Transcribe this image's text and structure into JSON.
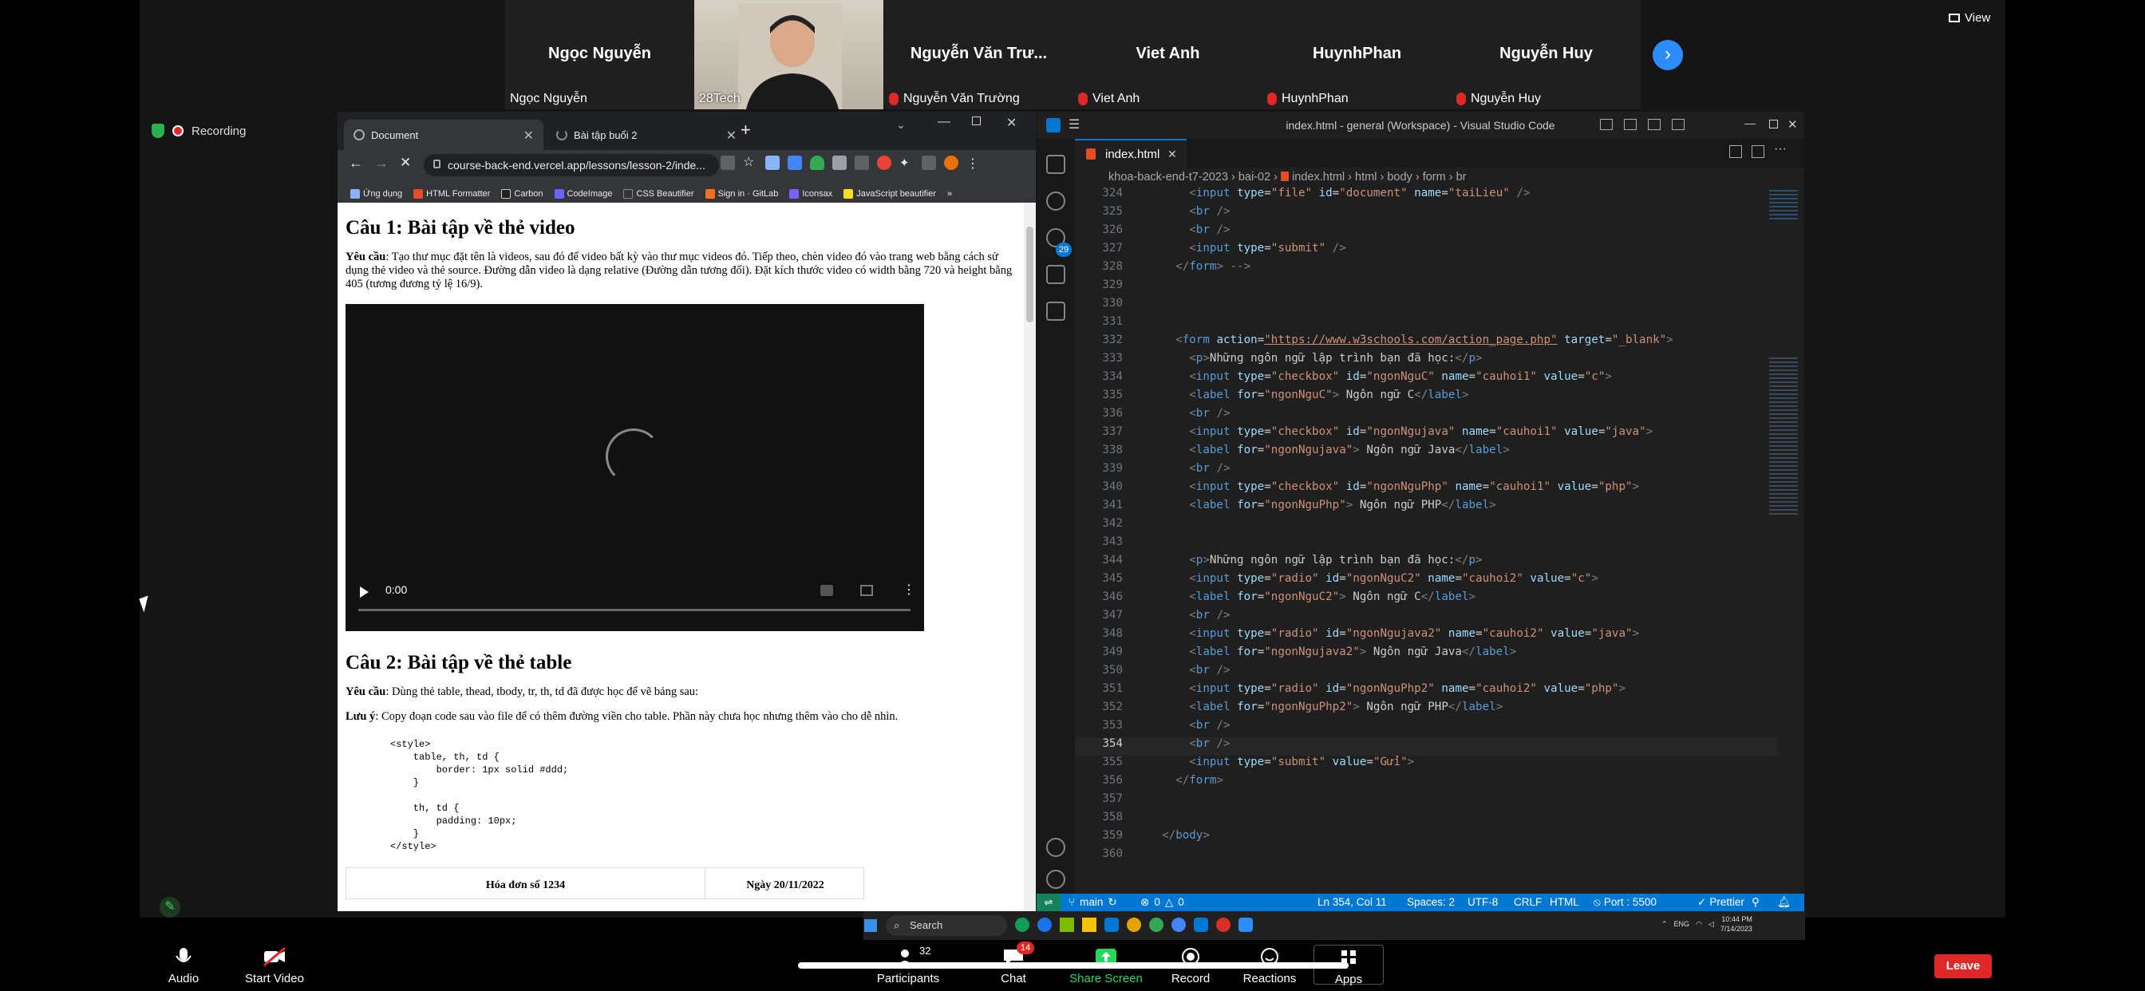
{
  "top_bar": {
    "view_label": "View"
  },
  "recording": {
    "label": "Recording"
  },
  "participants_tiles": [
    {
      "name": "Ngọc Nguyễn",
      "subname": "Ngọc Nguyễn"
    },
    {
      "name": "",
      "subname": "28Tech"
    },
    {
      "name": "Nguyễn Văn Trư...",
      "subname": "Nguyễn Văn Trường"
    },
    {
      "name": "Viet Anh",
      "subname": "Viet Anh"
    },
    {
      "name": "HuynhPhan",
      "subname": "HuynhPhan"
    },
    {
      "name": "Nguyễn Huy",
      "subname": "Nguyễn Huy"
    }
  ],
  "browser": {
    "tabs": [
      {
        "label": "Document"
      },
      {
        "label": "Bài tập buổi 2"
      }
    ],
    "url": "course-back-end.vercel.app/lessons/lesson-2/inde...",
    "bookmarks": [
      "Ứng dụng",
      "HTML Formatter",
      "Carbon",
      "CodeImage",
      "CSS Beautifier",
      "Sign in · GitLab",
      "Iconsax",
      "JavaScript beautifier"
    ],
    "content": {
      "h1": "Câu 1: Bài tập về thẻ video",
      "req1_label": "Yêu cầu",
      "req1_text": ": Tạo thư mục đặt tên là videos, sau đó để video bất kỳ vào thư mục videos đó. Tiếp theo, chèn video đó vào trang web bằng cách sử dụng thẻ video và thẻ source. Đường dẫn video là dạng relative (Đường dẫn tương đối). Đặt kích thước video có width bằng 720 và height bằng 405 (tương đương tỷ lệ 16/9).",
      "video_time": "0:00",
      "h2": "Câu 2: Bài tập về thẻ table",
      "req2_label": "Yêu cầu",
      "req2_text": ": Dùng thẻ table, thead, tbody, tr, th, td đã được học để vẽ bảng sau:",
      "note_label": "Lưu ý",
      "note_text": ": Copy đoạn code sau vào file để có thêm đường viền cho table. Phần này chưa học nhưng thêm vào cho dễ nhìn.",
      "code": "<style>\n    table, th, td {\n        border: 1px solid #ddd;\n    }\n\n    th, td {\n        padding: 10px;\n    }\n</style>",
      "table_h1": "Hóa đơn số 1234",
      "table_h2": "Ngày 20/11/2022"
    }
  },
  "vscode": {
    "title": "index.html - general (Workspace) - Visual Studio Code",
    "tab": "index.html",
    "breadcrumb": [
      "khoa-back-end-t7-2023",
      "bai-02",
      "index.html",
      "html",
      "body",
      "form",
      "br"
    ],
    "activity_badge": "29",
    "status": {
      "branch": "main",
      "problems": "0",
      "warnings": "0",
      "position": "Ln 354, Col 11",
      "spaces": "Spaces: 2",
      "encoding": "UTF-8",
      "eol": "CRLF",
      "lang": "HTML",
      "port": "Port : 5500",
      "prettier": "Prettier"
    }
  },
  "taskbar": {
    "search": "Search",
    "time": "10:44 PM",
    "date": "7/14/2023",
    "lang": "ENG"
  },
  "zoom": {
    "audio": "Audio",
    "start_video": "Start Video",
    "participants": "Participants",
    "participants_count": "32",
    "chat": "Chat",
    "chat_badge": "14",
    "share": "Share Screen",
    "record": "Record",
    "reactions": "Reactions",
    "apps": "Apps",
    "leave": "Leave"
  }
}
